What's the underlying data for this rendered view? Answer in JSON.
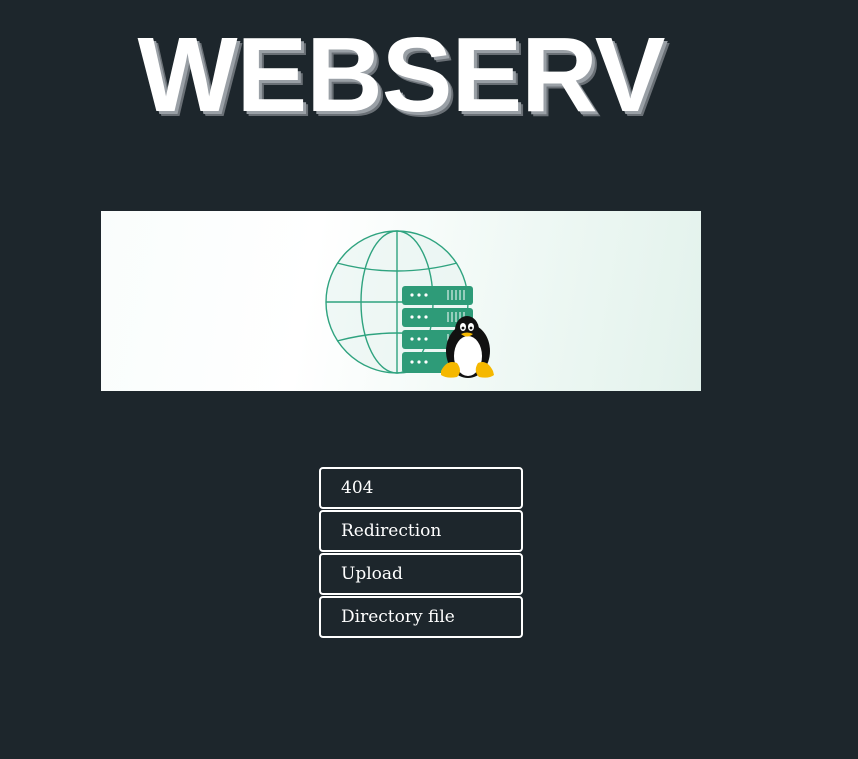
{
  "header": {
    "title": "WEBSERV"
  },
  "banner": {
    "image": "globe-server-penguin-illustration",
    "colors": {
      "globe": "#2fa37f",
      "server": "#2e9b78",
      "penguin_body": "#111111",
      "penguin_feet": "#f5b800"
    }
  },
  "menu": {
    "items": [
      {
        "label": "404"
      },
      {
        "label": "Redirection"
      },
      {
        "label": "Upload"
      },
      {
        "label": "Directory file"
      }
    ]
  },
  "colors": {
    "background": "#1d262c",
    "button_border": "#ffffff",
    "text": "#ffffff"
  }
}
